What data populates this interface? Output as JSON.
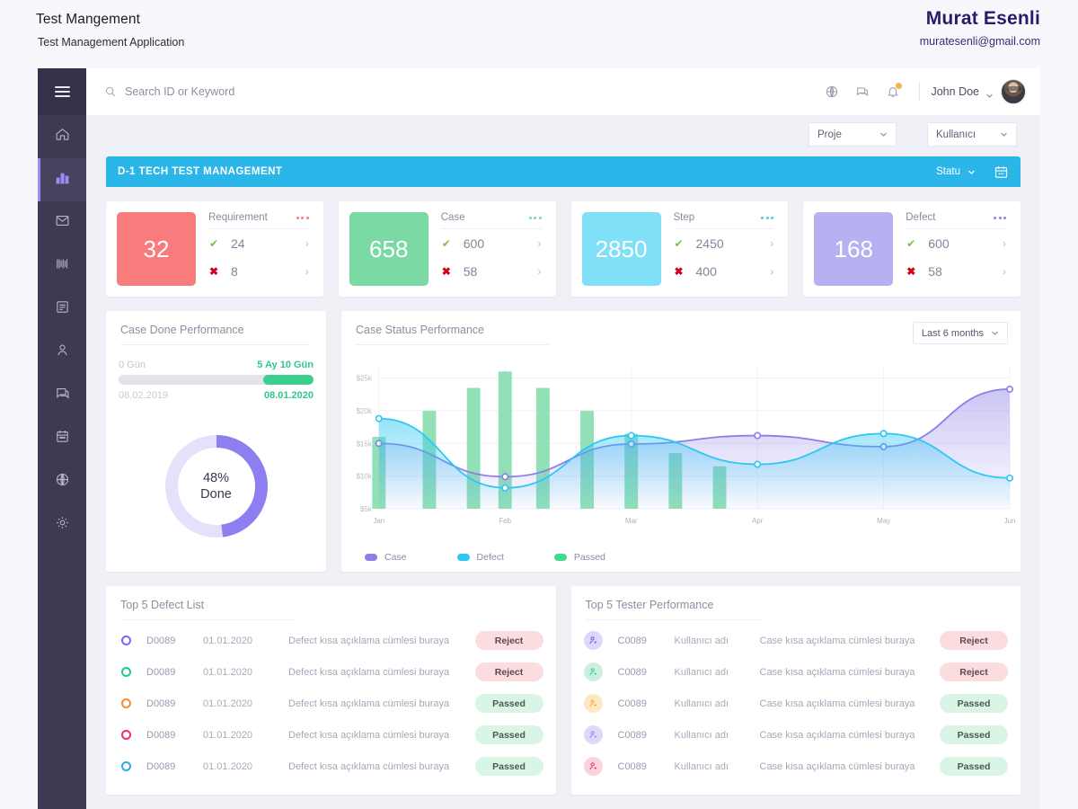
{
  "page_header": {
    "title": "Test Mangement",
    "subtitle": "Test Management Application",
    "author_name": "Murat Esenli",
    "author_email": "muratesenli@gmail.com"
  },
  "sidebar": {
    "items": [
      {
        "name": "home",
        "icon": "home-icon"
      },
      {
        "name": "dashboard",
        "icon": "bar-chart-icon",
        "active": true
      },
      {
        "name": "mail",
        "icon": "envelope-icon"
      },
      {
        "name": "barcode",
        "icon": "barcode-icon"
      },
      {
        "name": "reports",
        "icon": "book-icon"
      },
      {
        "name": "users",
        "icon": "person-icon"
      },
      {
        "name": "messages",
        "icon": "chat-icon"
      },
      {
        "name": "calendar",
        "icon": "calendar-icon"
      },
      {
        "name": "globe",
        "icon": "globe-icon"
      },
      {
        "name": "settings",
        "icon": "gear-icon"
      }
    ]
  },
  "topbar": {
    "search_placeholder": "Search ID or Keyword",
    "search_value": "",
    "icons": [
      "globe-icon",
      "chat-icon",
      "bell-icon"
    ],
    "notification_badge": true,
    "user_name": "John Doe"
  },
  "filters": {
    "project": "Proje",
    "user": "Kullanıcı"
  },
  "project_bar": {
    "title": "D-1 TECH TEST MANAGEMENT",
    "status_label": "Statu",
    "calendar_icon": "calendar-icon",
    "color": "#2ab6e8"
  },
  "stats": [
    {
      "label": "Requirement",
      "total": "32",
      "passed": "24",
      "failed": "8",
      "color": "#f97c7c"
    },
    {
      "label": "Case",
      "total": "658",
      "passed": "600",
      "failed": "58",
      "color": "#7bdaa4"
    },
    {
      "label": "Step",
      "total": "2850",
      "passed": "2450",
      "failed": "400",
      "color": "#7fe0f7"
    },
    {
      "label": "Defect",
      "total": "168",
      "passed": "600",
      "failed": "58",
      "color": "#b7b1f2"
    }
  ],
  "case_done_performance": {
    "title": "Case Done Performance",
    "range_start_label": "0 Gün",
    "range_end_label": "5 Ay 10 Gün",
    "date_start": "08.02.2019",
    "date_end": "08.01.2020",
    "progress_percent": 26,
    "donut_percent": "48%",
    "donut_label": "Done",
    "donut_value": 48
  },
  "case_status_performance": {
    "title": "Case Status Performance",
    "range_selector": "Last 6 months"
  },
  "chart_data": {
    "type": "bar",
    "title": "Case Status Performance",
    "xlabel": "",
    "ylabel": "",
    "ylim": [
      5000,
      27000
    ],
    "grid": true,
    "legend_position": "bottom",
    "tick_labels_y": [
      "$5k",
      "$10k",
      "$15k",
      "$20k",
      "$25k"
    ],
    "tick_values_y": [
      5000,
      10000,
      15000,
      20000,
      25000
    ],
    "categories": [
      "Jan",
      "Feb",
      "Mar",
      "Apr",
      "May",
      "Jun"
    ],
    "bars": {
      "name": "Passed",
      "color": "#7fdca9",
      "x": [
        1.0,
        1.4,
        1.75,
        2.0,
        2.3,
        2.65,
        3.0,
        3.35,
        3.7
      ],
      "values": [
        16000,
        20000,
        23500,
        26000,
        23500,
        20000,
        16500,
        13500,
        11500
      ]
    },
    "series": [
      {
        "name": "Case",
        "color": "#8b7fe8",
        "x": [
          "Jan",
          "Feb",
          "Mar",
          "Apr",
          "May",
          "Jun"
        ],
        "values": [
          15000,
          9900,
          14900,
          16200,
          14500,
          23300
        ]
      },
      {
        "name": "Defect",
        "color": "#2dc7f5",
        "x": [
          "Jan",
          "Feb",
          "Mar",
          "Apr",
          "May",
          "Jun"
        ],
        "values": [
          18800,
          8200,
          16200,
          11800,
          16500,
          9700
        ]
      }
    ],
    "legend": [
      "Case",
      "Defect",
      "Passed"
    ]
  },
  "defect_list": {
    "title": "Top 5 Defect List",
    "rows": [
      {
        "ring_color": "#7b68ee",
        "id": "D0089",
        "date": "01.01.2020",
        "desc": "Defect kısa açıklama cümlesi buraya",
        "status": "Reject"
      },
      {
        "ring_color": "#23c98a",
        "id": "D0089",
        "date": "01.01.2020",
        "desc": "Defect kısa açıklama cümlesi buraya",
        "status": "Reject"
      },
      {
        "ring_color": "#f58a2e",
        "id": "D0089",
        "date": "01.01.2020",
        "desc": "Defect kısa açıklama cümlesi buraya",
        "status": "Passed"
      },
      {
        "ring_color": "#ef2a7b",
        "id": "D0089",
        "date": "01.01.2020",
        "desc": "Defect kısa açıklama cümlesi buraya",
        "status": "Passed"
      },
      {
        "ring_color": "#2ea8ef",
        "id": "D0089",
        "date": "01.01.2020",
        "desc": "Defect kısa açıklama cümlesi buraya",
        "status": "Passed"
      }
    ]
  },
  "tester_performance": {
    "title": "Top 5 Tester Performance",
    "rows": [
      {
        "avatar_bg": "#dcd7fb",
        "avatar_fg": "#6a5ae0",
        "id": "C0089",
        "user": "Kullanıcı adı",
        "desc": "Case kısa açıklama cümlesi buraya",
        "status": "Reject"
      },
      {
        "avatar_bg": "#cdf0de",
        "avatar_fg": "#23c98a",
        "id": "C0089",
        "user": "Kullanıcı adı",
        "desc": "Case kısa açıklama cümlesi buraya",
        "status": "Reject"
      },
      {
        "avatar_bg": "#fde8c6",
        "avatar_fg": "#f5a623",
        "id": "C0089",
        "user": "Kullanıcı adı",
        "desc": "Case kısa açıklama cümlesi buraya",
        "status": "Passed"
      },
      {
        "avatar_bg": "#ded9f9",
        "avatar_fg": "#8b7fe8",
        "id": "C0089",
        "user": "Kullanıcı adı",
        "desc": "Case kısa açıklama cümlesi buraya",
        "status": "Passed"
      },
      {
        "avatar_bg": "#fbd3db",
        "avatar_fg": "#ef2a7b",
        "id": "C0089",
        "user": "Kullanıcı adı",
        "desc": "Case kısa açıklama cümlesi buraya",
        "status": "Passed"
      }
    ]
  }
}
